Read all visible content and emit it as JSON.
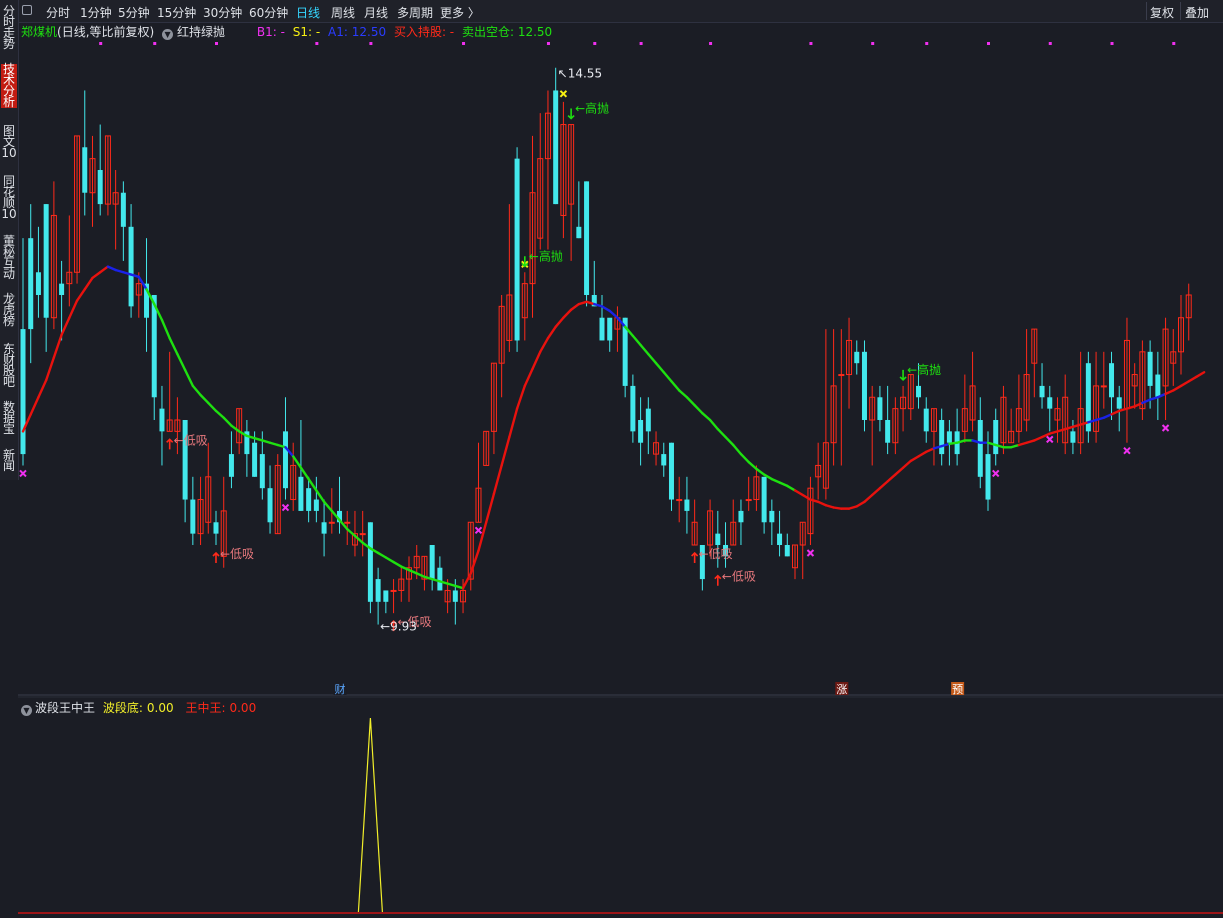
{
  "toolbar": {
    "periods": [
      "分时",
      "1分钟",
      "5分钟",
      "15分钟",
      "30分钟",
      "60分钟",
      "日线",
      "周线",
      "月线",
      "多周期",
      "更多 〉"
    ],
    "active_period": "日线",
    "right_buttons": [
      "复权",
      "叠加"
    ]
  },
  "sidebar": {
    "items": [
      {
        "label": "分时走势",
        "active": false
      },
      {
        "label": "技术分析",
        "active": true
      },
      {
        "label": "图文10",
        "active": false
      },
      {
        "label": "同花顺10",
        "active": false
      },
      {
        "label": "董秘互动",
        "active": false
      },
      {
        "label": "龙虎榜",
        "active": false
      },
      {
        "label": "东财股吧",
        "active": false
      },
      {
        "label": "数据宝",
        "active": false
      },
      {
        "label": "新闻",
        "active": false
      }
    ]
  },
  "main_legend": {
    "stock": "郑煤机",
    "mode": "(日线,等比前复权)",
    "indicator": "红持绿抛",
    "b1": "B1: -",
    "s1": "S1: -",
    "a1": "A1: 12.50",
    "buy_hold": "买入持股: -",
    "sell_empty": "卖出空仓: 12.50"
  },
  "sub_legend": {
    "indicator": "波段王中王",
    "bottom_label": "波段底:",
    "bottom_value": "0.00",
    "king_label": "王中王:",
    "king_value": "0.00"
  },
  "colors": {
    "up": "#ff2a1a",
    "down": "#43e8ec",
    "line_up": "#e8120e",
    "line_down": "#1ee010",
    "line_flat": "#1a22e8",
    "buy_text": "#e6787d",
    "sell_text": "#1ee010",
    "marker_x": "#f030f0",
    "marker_yellow": "#f7f012",
    "wave": "#f2ef2a",
    "bg": "#1b1d25"
  },
  "chart_data": {
    "type": "candlestick",
    "ylim": [
      9.5,
      15.0
    ],
    "candles": [
      [
        12.5,
        11.4,
        13.3,
        11.3
      ],
      [
        13.3,
        12.5,
        13.6,
        12.2
      ],
      [
        13.0,
        12.8,
        13.4,
        12.6
      ],
      [
        13.6,
        12.6,
        13.6,
        12.3
      ],
      [
        12.6,
        13.5,
        13.8,
        12.5
      ],
      [
        12.9,
        12.8,
        13.1,
        12.4
      ],
      [
        12.9,
        13.0,
        13.5,
        12.7
      ],
      [
        13.0,
        14.2,
        14.2,
        12.9
      ],
      [
        14.1,
        13.7,
        14.6,
        13.5
      ],
      [
        13.7,
        14.0,
        14.2,
        13.4
      ],
      [
        13.9,
        13.6,
        14.3,
        13.5
      ],
      [
        13.6,
        14.2,
        14.2,
        13.5
      ],
      [
        13.6,
        13.7,
        13.9,
        13.2
      ],
      [
        13.7,
        13.4,
        13.8,
        13.1
      ],
      [
        13.4,
        12.7,
        13.6,
        12.6
      ],
      [
        12.8,
        12.9,
        13.0,
        12.6
      ],
      [
        12.9,
        12.6,
        13.3,
        12.3
      ],
      [
        12.8,
        11.9,
        12.8,
        11.7
      ],
      [
        11.8,
        11.6,
        12.0,
        11.3
      ],
      [
        11.6,
        11.7,
        12.3,
        11.6
      ],
      [
        11.6,
        11.7,
        11.9,
        11.4
      ],
      [
        11.7,
        11.0,
        11.7,
        10.8
      ],
      [
        11.0,
        10.7,
        11.2,
        10.6
      ],
      [
        10.7,
        11.0,
        11.2,
        10.6
      ],
      [
        10.8,
        11.2,
        11.5,
        10.7
      ],
      [
        10.8,
        10.7,
        10.9,
        10.6
      ],
      [
        10.5,
        10.9,
        11.2,
        10.4
      ],
      [
        11.4,
        11.2,
        11.6,
        11.1
      ],
      [
        11.5,
        11.8,
        11.8,
        11.4
      ],
      [
        11.6,
        11.4,
        11.7,
        11.2
      ],
      [
        11.5,
        11.2,
        11.6,
        11.2
      ],
      [
        11.4,
        11.1,
        11.6,
        11.0
      ],
      [
        11.1,
        10.8,
        11.3,
        10.7
      ],
      [
        10.7,
        11.3,
        11.4,
        10.7
      ],
      [
        11.6,
        11.1,
        11.9,
        11.0
      ],
      [
        11.0,
        11.3,
        11.5,
        10.9
      ],
      [
        11.2,
        10.9,
        11.7,
        10.9
      ],
      [
        11.1,
        10.9,
        11.2,
        10.8
      ],
      [
        11.0,
        10.9,
        11.2,
        10.8
      ],
      [
        10.8,
        10.7,
        11.0,
        10.5
      ],
      [
        10.8,
        10.8,
        11.1,
        10.7
      ],
      [
        10.9,
        10.8,
        11.2,
        10.7
      ],
      [
        10.8,
        10.8,
        10.9,
        10.6
      ],
      [
        10.6,
        10.7,
        10.9,
        10.5
      ],
      [
        10.7,
        10.7,
        10.9,
        10.5
      ],
      [
        10.8,
        10.1,
        10.8,
        10.0
      ],
      [
        10.3,
        10.1,
        10.4,
        9.9
      ],
      [
        10.2,
        10.1,
        10.2,
        10.0
      ],
      [
        10.2,
        10.2,
        10.3,
        10.0
      ],
      [
        10.2,
        10.3,
        10.4,
        10.1
      ],
      [
        10.3,
        10.4,
        10.5,
        10.1
      ],
      [
        10.4,
        10.5,
        10.6,
        10.3
      ],
      [
        10.3,
        10.5,
        10.5,
        10.2
      ],
      [
        10.6,
        10.3,
        10.6,
        10.2
      ],
      [
        10.4,
        10.2,
        10.5,
        10.2
      ],
      [
        10.1,
        10.2,
        10.3,
        10.0
      ],
      [
        10.2,
        10.1,
        10.3,
        9.9
      ],
      [
        10.1,
        10.2,
        10.3,
        10.0
      ],
      [
        10.3,
        10.8,
        10.8,
        10.2
      ],
      [
        10.8,
        11.1,
        11.5,
        10.8
      ],
      [
        11.3,
        11.6,
        11.6,
        11.3
      ],
      [
        11.6,
        12.2,
        12.2,
        11.4
      ],
      [
        12.2,
        12.7,
        12.8,
        11.9
      ],
      [
        12.4,
        12.8,
        13.6,
        12.3
      ],
      [
        14.0,
        12.4,
        14.1,
        12.3
      ],
      [
        12.6,
        12.9,
        13.0,
        12.4
      ],
      [
        12.9,
        13.7,
        14.2,
        12.6
      ],
      [
        13.3,
        14.0,
        14.4,
        13.2
      ],
      [
        14.0,
        14.4,
        14.6,
        13.2
      ],
      [
        14.6,
        13.6,
        14.8,
        13.6
      ],
      [
        13.5,
        14.3,
        14.5,
        13.3
      ],
      [
        13.6,
        14.3,
        14.3,
        13.1
      ],
      [
        13.4,
        13.3,
        13.8,
        13.3
      ],
      [
        13.8,
        12.8,
        13.8,
        12.7
      ],
      [
        12.8,
        12.7,
        13.1,
        12.7
      ],
      [
        12.6,
        12.4,
        12.8,
        12.4
      ],
      [
        12.6,
        12.4,
        12.5,
        12.3
      ],
      [
        12.5,
        12.6,
        12.7,
        12.3
      ],
      [
        12.6,
        12.0,
        12.6,
        11.9
      ],
      [
        12.0,
        11.6,
        12.1,
        11.5
      ],
      [
        11.7,
        11.5,
        11.9,
        11.3
      ],
      [
        11.8,
        11.6,
        11.9,
        11.4
      ],
      [
        11.4,
        11.5,
        11.6,
        11.3
      ],
      [
        11.4,
        11.3,
        11.5,
        11.2
      ],
      [
        11.5,
        11.0,
        11.5,
        10.9
      ],
      [
        11.0,
        11.0,
        11.2,
        10.8
      ],
      [
        11.0,
        10.9,
        11.2,
        10.7
      ],
      [
        10.6,
        10.8,
        11.0,
        10.6
      ],
      [
        10.6,
        10.3,
        10.6,
        10.2
      ],
      [
        10.6,
        10.9,
        11.0,
        10.5
      ],
      [
        10.7,
        10.6,
        10.9,
        10.4
      ],
      [
        10.6,
        10.5,
        10.8,
        10.4
      ],
      [
        10.6,
        10.8,
        11.0,
        10.6
      ],
      [
        10.9,
        10.8,
        11.0,
        10.6
      ],
      [
        11.0,
        11.0,
        11.2,
        10.9
      ],
      [
        11.0,
        11.2,
        11.3,
        10.9
      ],
      [
        11.2,
        10.8,
        11.2,
        10.7
      ],
      [
        10.9,
        10.8,
        11.0,
        10.6
      ],
      [
        10.7,
        10.6,
        10.9,
        10.5
      ],
      [
        10.6,
        10.5,
        10.7,
        10.5
      ],
      [
        10.4,
        10.6,
        10.6,
        10.3
      ],
      [
        10.6,
        10.8,
        10.8,
        10.3
      ],
      [
        10.7,
        11.1,
        11.2,
        10.6
      ],
      [
        11.2,
        11.3,
        11.5,
        11.0
      ],
      [
        11.1,
        11.5,
        12.5,
        11.0
      ],
      [
        11.5,
        12.0,
        12.5,
        11.3
      ],
      [
        12.1,
        12.1,
        12.5,
        11.3
      ],
      [
        12.1,
        12.4,
        12.6,
        11.8
      ],
      [
        12.3,
        12.2,
        12.4,
        12.1
      ],
      [
        12.3,
        11.7,
        12.4,
        11.6
      ],
      [
        11.7,
        11.9,
        12.0,
        11.3
      ],
      [
        11.9,
        11.7,
        12.0,
        11.6
      ],
      [
        11.7,
        11.5,
        12.0,
        11.4
      ],
      [
        11.5,
        11.8,
        11.9,
        11.4
      ],
      [
        11.8,
        11.9,
        12.0,
        11.6
      ],
      [
        11.8,
        12.1,
        12.1,
        11.7
      ],
      [
        12.0,
        11.9,
        12.2,
        11.8
      ],
      [
        11.8,
        11.6,
        11.9,
        11.5
      ],
      [
        11.6,
        11.8,
        11.8,
        11.3
      ],
      [
        11.7,
        11.4,
        11.8,
        11.3
      ],
      [
        11.6,
        11.5,
        11.7,
        11.3
      ],
      [
        11.6,
        11.4,
        11.8,
        11.3
      ],
      [
        11.6,
        11.8,
        12.1,
        11.5
      ],
      [
        11.7,
        12.0,
        12.3,
        11.6
      ],
      [
        11.7,
        11.2,
        11.9,
        11.1
      ],
      [
        11.4,
        11.0,
        11.6,
        10.9
      ],
      [
        11.7,
        11.4,
        11.8,
        11.3
      ],
      [
        11.5,
        11.9,
        12.0,
        11.4
      ],
      [
        11.5,
        11.6,
        11.8,
        11.5
      ],
      [
        11.6,
        11.8,
        12.1,
        11.5
      ],
      [
        11.7,
        12.1,
        12.5,
        11.6
      ],
      [
        12.2,
        12.5,
        12.5,
        11.9
      ],
      [
        12.0,
        11.9,
        12.2,
        11.8
      ],
      [
        11.9,
        11.8,
        12.0,
        11.6
      ],
      [
        11.7,
        11.8,
        11.9,
        11.5
      ],
      [
        11.5,
        11.9,
        12.1,
        11.4
      ],
      [
        11.6,
        11.5,
        11.7,
        11.4
      ],
      [
        11.5,
        11.8,
        12.3,
        11.4
      ],
      [
        12.2,
        11.6,
        12.3,
        11.5
      ],
      [
        11.6,
        12.0,
        12.3,
        11.5
      ],
      [
        12.0,
        12.0,
        12.3,
        11.8
      ],
      [
        12.2,
        11.9,
        12.3,
        11.7
      ],
      [
        11.9,
        11.8,
        12.0,
        11.6
      ],
      [
        11.8,
        12.4,
        12.6,
        11.5
      ],
      [
        12.0,
        12.1,
        12.2,
        11.8
      ],
      [
        11.8,
        12.3,
        12.4,
        11.7
      ],
      [
        12.3,
        12.0,
        12.4,
        11.8
      ],
      [
        12.1,
        11.9,
        12.3,
        11.7
      ],
      [
        12.0,
        12.5,
        12.6,
        11.7
      ],
      [
        12.2,
        12.3,
        12.5,
        12.0
      ],
      [
        12.3,
        12.6,
        12.8,
        12.1
      ],
      [
        12.6,
        12.8,
        12.9,
        12.4
      ]
    ],
    "trend_line": [
      11.6,
      11.75,
      11.9,
      12.05,
      12.25,
      12.45,
      12.6,
      12.75,
      12.85,
      12.95,
      13.0,
      13.05,
      13.02,
      13.0,
      12.98,
      12.96,
      12.85,
      12.72,
      12.58,
      12.42,
      12.28,
      12.14,
      12.0,
      11.92,
      11.85,
      11.78,
      11.72,
      11.65,
      11.6,
      11.56,
      11.54,
      11.52,
      11.5,
      11.48,
      11.46,
      11.38,
      11.28,
      11.18,
      11.08,
      10.98,
      10.9,
      10.82,
      10.74,
      10.68,
      10.62,
      10.57,
      10.53,
      10.49,
      10.45,
      10.41,
      10.38,
      10.35,
      10.32,
      10.3,
      10.28,
      10.26,
      10.24,
      10.22,
      10.35,
      10.55,
      10.8,
      11.05,
      11.3,
      11.55,
      11.8,
      12.0,
      12.15,
      12.3,
      12.42,
      12.52,
      12.6,
      12.67,
      12.72,
      12.74,
      12.72,
      12.7,
      12.66,
      12.6,
      12.52,
      12.44,
      12.36,
      12.28,
      12.2,
      12.12,
      12.04,
      11.96,
      11.9,
      11.83,
      11.76,
      11.7,
      11.62,
      11.55,
      11.48,
      11.4,
      11.33,
      11.27,
      11.22,
      11.18,
      11.15,
      11.12,
      11.08,
      11.04,
      11.0,
      10.98,
      10.95,
      10.93,
      10.92,
      10.92,
      10.94,
      10.98,
      11.04,
      11.1,
      11.16,
      11.22,
      11.28,
      11.34,
      11.38,
      11.42,
      11.45,
      11.47,
      11.49,
      11.5,
      11.52,
      11.52,
      11.5,
      11.5,
      11.48,
      11.46,
      11.46,
      11.48,
      11.5,
      11.52,
      11.55,
      11.58,
      11.6,
      11.62,
      11.64,
      11.66,
      11.68,
      11.7,
      11.72,
      11.75,
      11.78,
      11.8,
      11.82,
      11.85,
      11.88,
      11.9,
      11.93,
      11.96,
      12.0,
      12.04,
      12.08,
      12.12
    ],
    "trend_colors": [
      "r",
      "r",
      "r",
      "r",
      "r",
      "r",
      "r",
      "r",
      "r",
      "r",
      "r",
      "b",
      "b",
      "b",
      "b",
      "b",
      "g",
      "g",
      "g",
      "g",
      "g",
      "g",
      "g",
      "g",
      "g",
      "g",
      "g",
      "g",
      "g",
      "g",
      "g",
      "g",
      "g",
      "g",
      "b",
      "g",
      "g",
      "g",
      "g",
      "g",
      "g",
      "g",
      "g",
      "g",
      "g",
      "g",
      "g",
      "g",
      "g",
      "g",
      "g",
      "g",
      "g",
      "g",
      "g",
      "g",
      "g",
      "r",
      "r",
      "r",
      "r",
      "r",
      "r",
      "r",
      "r",
      "r",
      "r",
      "r",
      "r",
      "r",
      "r",
      "r",
      "r",
      "r",
      "b",
      "b",
      "b",
      "b",
      "g",
      "g",
      "g",
      "g",
      "g",
      "g",
      "g",
      "g",
      "g",
      "g",
      "g",
      "g",
      "g",
      "g",
      "g",
      "g",
      "g",
      "g",
      "g",
      "g",
      "g",
      "g",
      "r",
      "r",
      "r",
      "r",
      "r",
      "r",
      "r",
      "r",
      "r",
      "r",
      "r",
      "r",
      "r",
      "r",
      "r",
      "r",
      "r",
      "r",
      "b",
      "b",
      "g",
      "g",
      "g",
      "b",
      "b",
      "g",
      "g",
      "g",
      "g",
      "r",
      "r",
      "r",
      "r",
      "r",
      "r",
      "r",
      "r",
      "r",
      "b",
      "b",
      "b",
      "r",
      "r",
      "r",
      "r",
      "b",
      "b",
      "b",
      "r",
      "r",
      "r",
      "r",
      "r",
      "r",
      "r",
      "r"
    ],
    "high_label": "14.55",
    "low_label": "9.93",
    "buy_signals": [
      {
        "i": 19,
        "text": "←低吸"
      },
      {
        "i": 25,
        "text": "←低吸"
      },
      {
        "i": 48,
        "text": "←低吸"
      },
      {
        "i": 87,
        "text": "←低吸"
      },
      {
        "i": 90,
        "text": "←低吸"
      }
    ],
    "sell_signals": [
      {
        "i": 65,
        "text": "←高抛"
      },
      {
        "i": 71,
        "text": "←高抛"
      },
      {
        "i": 114,
        "text": "←高抛"
      }
    ],
    "x_markers": [
      0,
      34,
      59,
      102,
      126,
      133,
      143,
      148
    ],
    "yellow_markers": [
      65,
      70
    ],
    "event_markers": [
      {
        "i": 41,
        "text": "财",
        "bg": "#1b1d25",
        "color": "#5aa7ff"
      },
      {
        "i": 106,
        "text": "涨",
        "bg": "#6e1a14",
        "color": "#ffffff"
      },
      {
        "i": 121,
        "text": "预",
        "bg": "#c45a1a",
        "color": "#ffffff"
      }
    ],
    "top_dots": [
      10,
      17,
      25,
      38,
      45,
      57,
      68,
      74,
      80,
      89,
      102,
      110,
      117,
      125,
      133,
      141,
      149
    ]
  },
  "sub_chart": {
    "type": "line",
    "ylim": [
      0,
      1
    ],
    "spike_index": 45,
    "spike_value": 1.0
  }
}
